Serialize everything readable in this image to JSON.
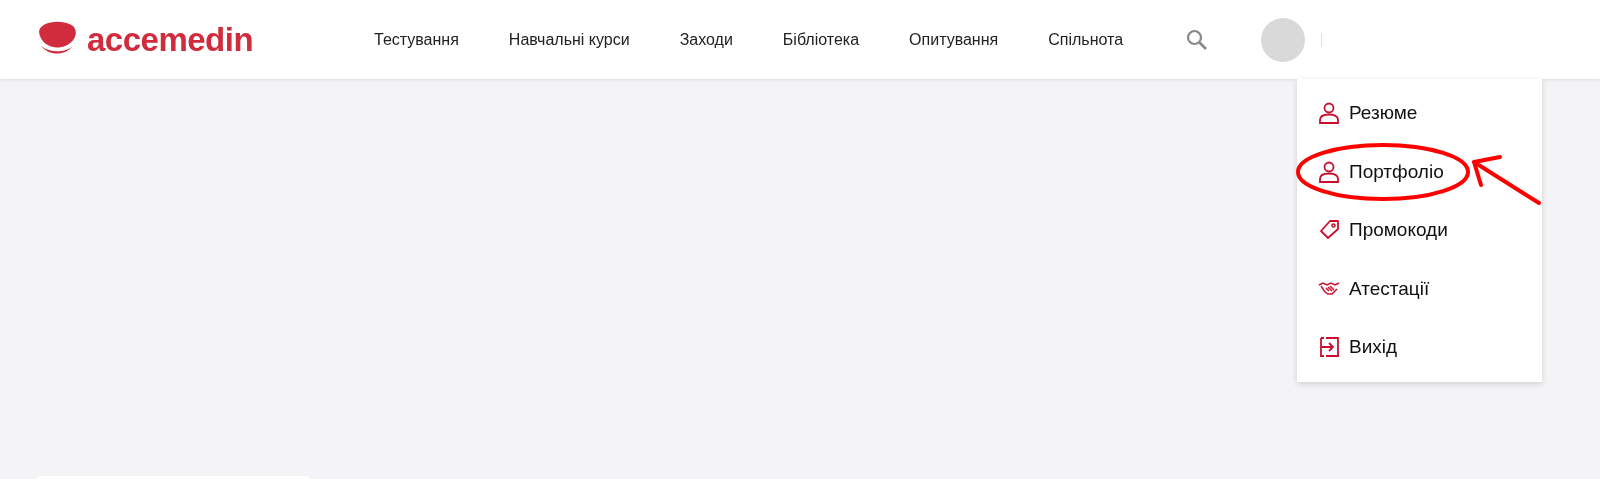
{
  "logo": {
    "text": "accemedin"
  },
  "nav": [
    {
      "label": "Тестування"
    },
    {
      "label": "Навчальні курси"
    },
    {
      "label": "Заходи"
    },
    {
      "label": "Бібліотека"
    },
    {
      "label": "Опитування"
    },
    {
      "label": "Спільнота"
    }
  ],
  "user_menu": {
    "expanded": true,
    "items": [
      {
        "label": "Резюме",
        "kind": "person",
        "circled": false
      },
      {
        "label": "Портфоліо",
        "kind": "person",
        "circled": true
      },
      {
        "label": "Промокоди",
        "kind": "tag",
        "circled": false
      },
      {
        "label": "Атестації",
        "kind": "handshake",
        "circled": false
      },
      {
        "label": "Вихід",
        "kind": "exit",
        "circled": false
      }
    ]
  }
}
